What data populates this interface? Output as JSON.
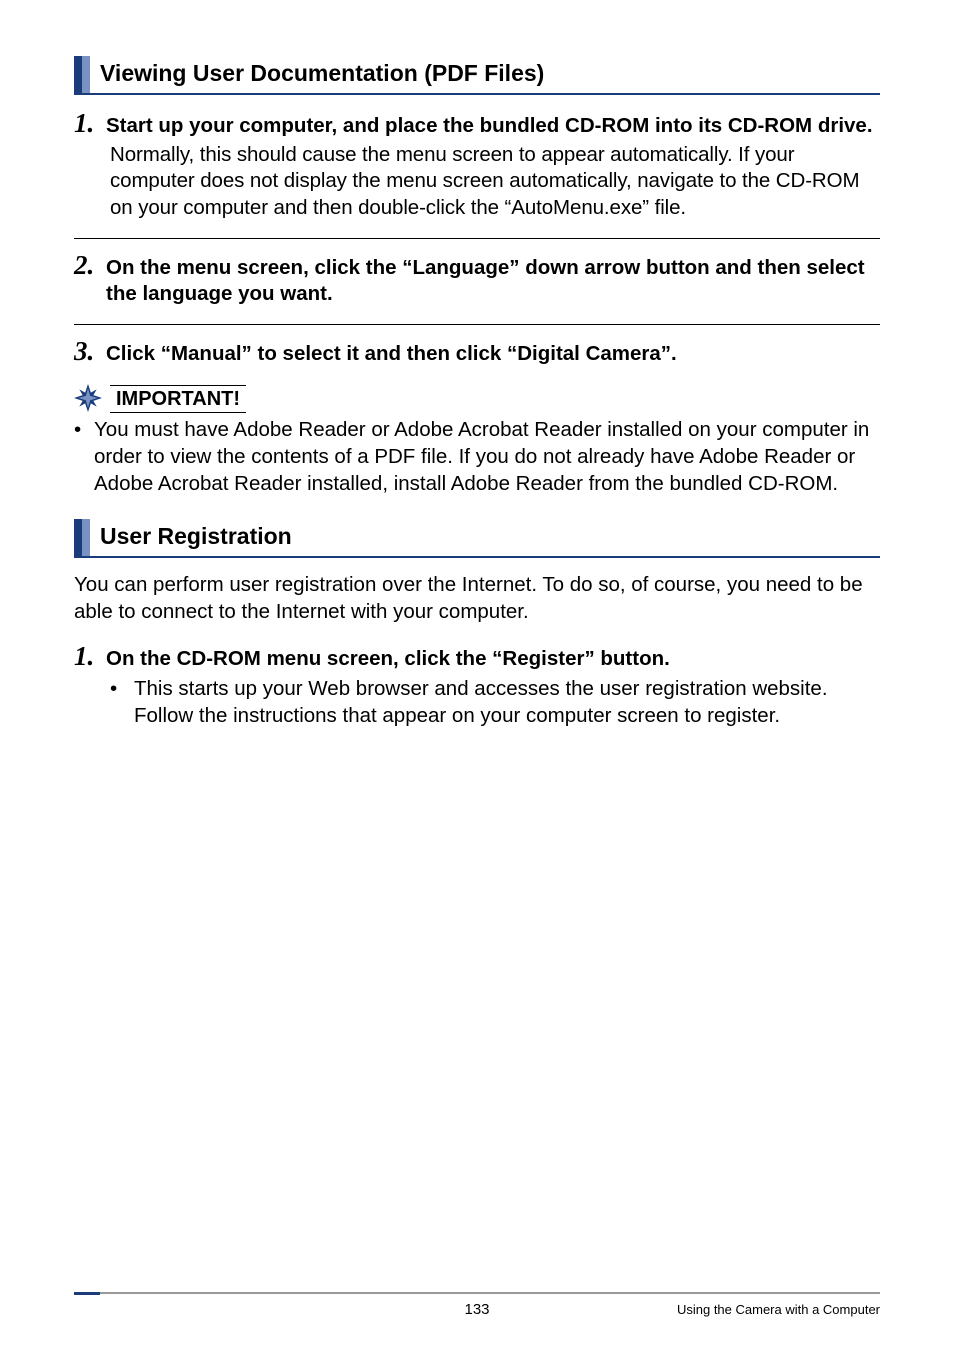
{
  "section1": {
    "title": "Viewing User Documentation (PDF Files)",
    "step1_title": "Start up your computer, and place the bundled CD-ROM into its CD-ROM drive.",
    "step1_body": "Normally, this should cause the menu screen to appear automatically. If your computer does not display the menu screen automatically, navigate to the CD-ROM on your computer and then double-click the “AutoMenu.exe” file.",
    "step2_title": "On the menu screen, click the “Language” down arrow button and then select the language you want.",
    "step3_title": "Click “Manual” to select it and then click “Digital Camera”."
  },
  "important": {
    "label": "IMPORTANT!",
    "bullet": "You must have Adobe Reader or Adobe Acrobat Reader installed on your computer in order to view the contents of a PDF file. If you do not already have Adobe Reader or Adobe Acrobat Reader installed, install Adobe Reader from the bundled CD-ROM."
  },
  "section2": {
    "title": "User Registration",
    "body": "You can perform user registration over the Internet. To do so, of course, you need to be able to connect to the Internet with your computer.",
    "step1_title": "On the CD-ROM menu screen, click the “Register” button.",
    "step1_sub": "This starts up your Web browser and accesses the user registration website. Follow the instructions that appear on your computer screen to register."
  },
  "footer": {
    "page": "133",
    "context": "Using the Camera with a Computer"
  },
  "nums": {
    "n1": "1.",
    "n2": "2.",
    "n3": "3."
  }
}
